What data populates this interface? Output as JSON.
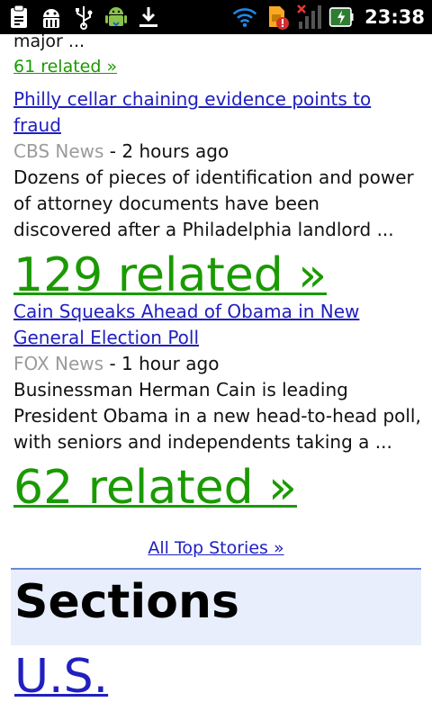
{
  "status_bar": {
    "time": "23:38",
    "icons": [
      "clipboard-icon",
      "android-debug-icon",
      "usb-icon",
      "android-market-icon",
      "download-icon",
      "wifi-icon",
      "sim-alert-icon",
      "signal-icon",
      "battery-charging-icon"
    ]
  },
  "news": {
    "previous_snippet_tail": "major ...",
    "previous_related": "61 related »",
    "stories": [
      {
        "title": "Philly cellar chaining evidence points to fraud",
        "source": "CBS News",
        "time": "- 2 hours ago",
        "snippet": "Dozens of pieces of identification and power of attorney documents have been discovered after a Philadelphia landlord ...",
        "related": "129 related »"
      },
      {
        "title": "Cain Squeaks Ahead of Obama in New General Election Poll",
        "source": "FOX News",
        "time": "- 1 hour ago",
        "snippet": "Businessman Herman Cain is leading President Obama in a new head-to-head poll, with seniors and independents taking a ...",
        "related": "62 related »"
      }
    ],
    "all_top_stories": "All Top Stories »"
  },
  "sections": {
    "title": "Sections",
    "first_link": "U.S."
  },
  "colors": {
    "link_blue": "#2020c0",
    "related_green": "#1a9a00",
    "source_gray": "#9b9b9b",
    "section_bg": "#e8eefc"
  }
}
